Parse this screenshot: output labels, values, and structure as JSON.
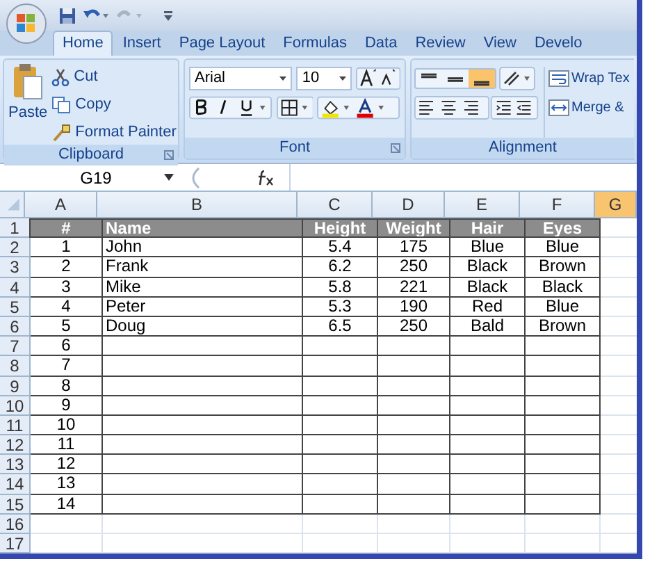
{
  "tabs": [
    {
      "label": "Home",
      "selected": true
    },
    {
      "label": "Insert",
      "selected": false
    },
    {
      "label": "Page Layout",
      "selected": false
    },
    {
      "label": "Formulas",
      "selected": false
    },
    {
      "label": "Data",
      "selected": false
    },
    {
      "label": "Review",
      "selected": false
    },
    {
      "label": "View",
      "selected": false
    },
    {
      "label": "Develo",
      "selected": false
    }
  ],
  "clipboard": {
    "paste": "Paste",
    "cut": "Cut",
    "copy": "Copy",
    "format_painter": "Format Painter",
    "label": "Clipboard"
  },
  "font": {
    "font_name": "Arial",
    "font_size": "10",
    "label": "Font"
  },
  "alignment": {
    "vertical": [
      {
        "selected": false
      },
      {
        "selected": false
      },
      {
        "selected": true
      }
    ],
    "wrap_text": "Wrap Tex",
    "merge": "Merge &",
    "label": "Alignment"
  },
  "formula_bar": {
    "name_box": "G19"
  },
  "columns": [
    {
      "label": "A",
      "selected": false
    },
    {
      "label": "B",
      "selected": false
    },
    {
      "label": "C",
      "selected": false
    },
    {
      "label": "D",
      "selected": false
    },
    {
      "label": "E",
      "selected": false
    },
    {
      "label": "F",
      "selected": false
    },
    {
      "label": "G",
      "selected": true
    }
  ],
  "rows": [
    {
      "number": "1",
      "kind": "header",
      "cells": [
        "#",
        "Name",
        "Height",
        "Weight",
        "Hair",
        "Eyes"
      ]
    },
    {
      "number": "2",
      "kind": "data",
      "cells": [
        "1",
        "John",
        "5.4",
        "175",
        "Blue",
        "Blue"
      ]
    },
    {
      "number": "3",
      "kind": "data",
      "cells": [
        "2",
        "Frank",
        "6.2",
        "250",
        "Black",
        "Brown"
      ]
    },
    {
      "number": "4",
      "kind": "data",
      "cells": [
        "3",
        "Mike",
        "5.8",
        "221",
        "Black",
        "Black"
      ]
    },
    {
      "number": "5",
      "kind": "data",
      "cells": [
        "4",
        "Peter",
        "5.3",
        "190",
        "Red",
        "Blue"
      ]
    },
    {
      "number": "6",
      "kind": "data",
      "cells": [
        "5",
        "Doug",
        "6.5",
        "250",
        "Bald",
        "Brown"
      ]
    },
    {
      "number": "7",
      "kind": "data",
      "cells": [
        "6"
      ]
    },
    {
      "number": "8",
      "kind": "data",
      "cells": [
        "7"
      ]
    },
    {
      "number": "9",
      "kind": "data",
      "cells": [
        "8"
      ]
    },
    {
      "number": "10",
      "kind": "data",
      "cells": [
        "9"
      ]
    },
    {
      "number": "11",
      "kind": "data",
      "cells": [
        "10"
      ]
    },
    {
      "number": "12",
      "kind": "data",
      "cells": [
        "11"
      ]
    },
    {
      "number": "13",
      "kind": "data",
      "cells": [
        "12"
      ]
    },
    {
      "number": "14",
      "kind": "data",
      "cells": [
        "13"
      ]
    },
    {
      "number": "15",
      "kind": "data",
      "cells": [
        "14"
      ]
    },
    {
      "number": "16",
      "kind": "blank"
    },
    {
      "number": "17",
      "kind": "blank"
    }
  ]
}
